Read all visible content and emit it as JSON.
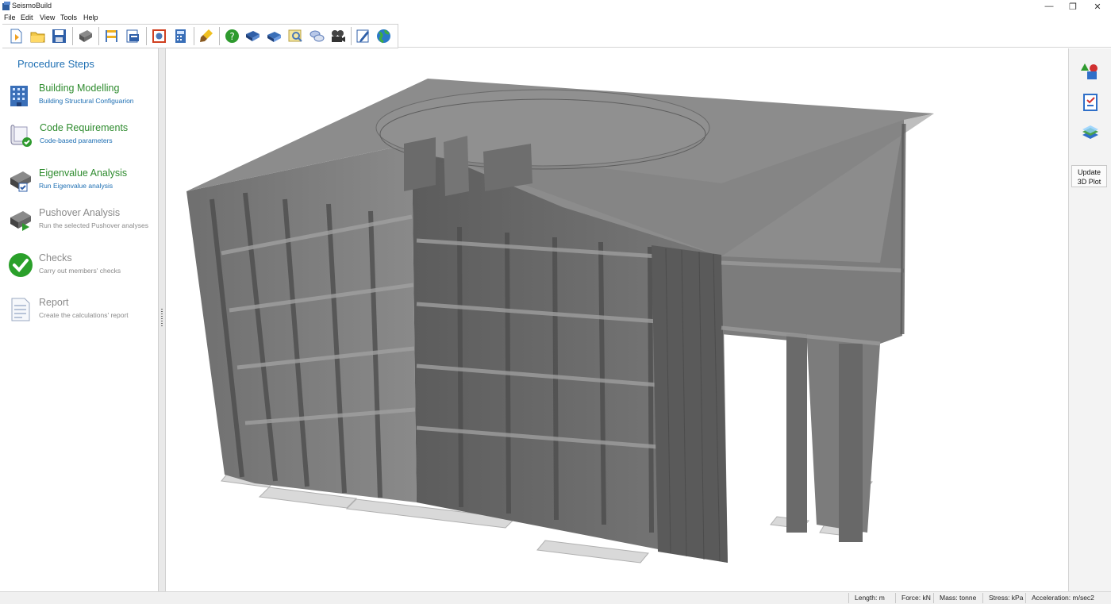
{
  "window": {
    "title": "SeismoBuild",
    "minimize": "—",
    "restore": "❐",
    "close": "✕"
  },
  "menu": [
    "File",
    "Edit",
    "View",
    "Tools",
    "Help"
  ],
  "toolbar": {
    "buttons": [
      "new-project-icon",
      "open-folder-icon",
      "save-icon",
      "run-analysis-icon",
      "building-frame-icon",
      "print-preview-icon",
      "settings-icon",
      "calculator-icon",
      "paint-brush-icon",
      "help-icon",
      "user-manual-icon",
      "tutorial-book-icon",
      "search-icon",
      "feedback-chat-icon",
      "video-tutorials-icon",
      "edit-notes-icon",
      "website-globe-icon"
    ]
  },
  "procedure": {
    "title": "Procedure Steps",
    "steps": [
      {
        "title": "Building Modelling",
        "subtitle": "Building Structural Configuarion",
        "icon": "building-icon",
        "active": true
      },
      {
        "title": "Code Requirements",
        "subtitle": "Code-based parameters",
        "icon": "code-scroll-icon",
        "active": true
      },
      {
        "title": "Eigenvalue Analysis",
        "subtitle": "Run Eigenvalue analysis",
        "icon": "eigenvalue-icon",
        "active": true
      },
      {
        "title": "Pushover Analysis",
        "subtitle": "Run the selected Pushover analyses",
        "icon": "pushover-icon",
        "active": false
      },
      {
        "title": "Checks",
        "subtitle": "Carry out members' checks",
        "icon": "checkmark-icon",
        "active": false
      },
      {
        "title": "Report",
        "subtitle": "Create the calculations' report",
        "icon": "report-icon",
        "active": false
      }
    ]
  },
  "right_panel": {
    "update_label_1": "Update",
    "update_label_2": "3D Plot"
  },
  "status": {
    "length": "Length: m",
    "force": "Force: kN",
    "mass": "Mass: tonne",
    "stress": "Stress: kPa",
    "acceleration": "Acceleration: m/sec2"
  },
  "colors": {
    "accent_blue": "#1e6fb3",
    "active_green": "#2e8b2e",
    "dim_gray": "#8a8a8a",
    "model_gray": "#7a7a7a"
  }
}
